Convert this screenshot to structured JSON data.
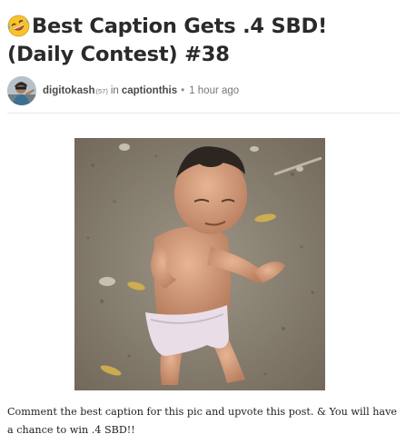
{
  "post": {
    "title": "Best Caption Gets .4 SBD! (Daily Contest) #38",
    "title_emoji_icon": "rolling-on-floor-laughing-emoji-icon",
    "author": "digitokash",
    "reputation": "(57)",
    "in_word": "in",
    "community": "captionthis",
    "separator": "•",
    "time": "1 hour ago",
    "body": "Comment the best caption for this pic and upvote this post. & You will have a chance to win .4 SBD!!"
  },
  "colors": {
    "title": "#2a2a2a",
    "meta": "#6b6b6b",
    "divider": "#e8e8e8",
    "body": "#222222"
  }
}
